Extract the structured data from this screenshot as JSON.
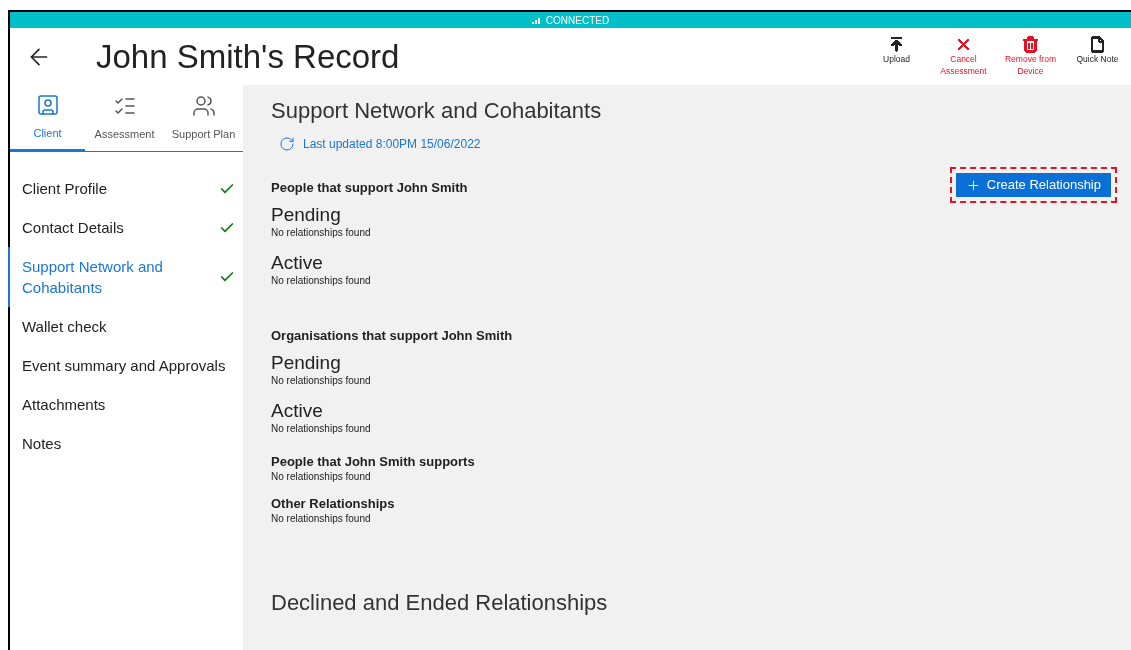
{
  "status_bar": {
    "text": "CONNECTED"
  },
  "header": {
    "title": "John Smith's Record"
  },
  "actions": [
    {
      "label": "Upload",
      "kind": "upload",
      "color": "#222222"
    },
    {
      "label": "Cancel Assessment",
      "kind": "cancel",
      "color": "#e81123"
    },
    {
      "label": "Remove from Device",
      "kind": "remove",
      "color": "#e81123"
    },
    {
      "label": "Quick Note",
      "kind": "note",
      "color": "#222222"
    }
  ],
  "tabs": [
    {
      "label": "Client",
      "kind": "client",
      "selected": true
    },
    {
      "label": "Assessment",
      "kind": "assessment",
      "selected": false
    },
    {
      "label": "Support Plan",
      "kind": "plan",
      "selected": false
    }
  ],
  "nav": [
    {
      "label": "Client Profile",
      "checked": true,
      "selected": false
    },
    {
      "label": "Contact Details",
      "checked": true,
      "selected": false
    },
    {
      "label": "Support Network and Cohabitants",
      "checked": true,
      "selected": true
    },
    {
      "label": "Wallet check",
      "checked": false,
      "selected": false
    },
    {
      "label": "Event summary and Approvals",
      "checked": false,
      "selected": false
    },
    {
      "label": "Attachments",
      "checked": false,
      "selected": false
    },
    {
      "label": "Notes",
      "checked": false,
      "selected": false
    }
  ],
  "main": {
    "title": "Support Network and Cohabitants",
    "last_updated": "Last updated 8:00PM 15/06/2022",
    "create_button": {
      "label": "Create Relationship",
      "highlighted": true
    },
    "sections": [
      {
        "kind": "grouped",
        "heading": "People that support John Smith",
        "subsections": [
          {
            "title": "Pending",
            "message": "No relationships found"
          },
          {
            "title": "Active",
            "message": "No relationships found"
          }
        ]
      },
      {
        "kind": "grouped",
        "heading": "Organisations that support John Smith",
        "subsections": [
          {
            "title": "Pending",
            "message": "No relationships found"
          },
          {
            "title": "Active",
            "message": "No relationships found"
          }
        ]
      },
      {
        "kind": "simple",
        "heading": "People that John Smith supports",
        "message": "No relationships found"
      },
      {
        "kind": "simple",
        "heading": "Other Relationships",
        "message": "No relationships found"
      }
    ],
    "footer_heading": "Declined and Ended Relationships"
  }
}
